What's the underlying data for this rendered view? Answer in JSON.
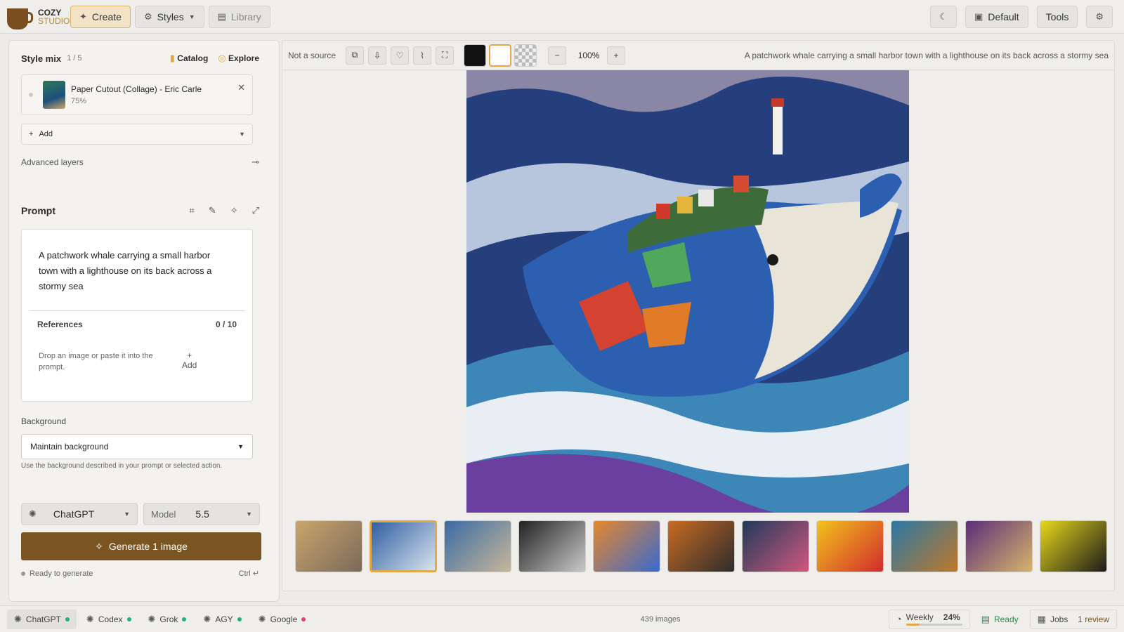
{
  "app": {
    "logo_line1": "COZY",
    "logo_line2": "STUDIO"
  },
  "topbar": {
    "create": "Create",
    "styles": "Styles",
    "library": "Library",
    "preset": "Default",
    "tools": "Tools"
  },
  "style_mix": {
    "title": "Style mix",
    "count": "1 / 5",
    "catalog": "Catalog",
    "explore": "Explore",
    "item_name": "Paper Cutout (Collage) - Eric Carle",
    "item_weight": "75%",
    "add": "Add",
    "advanced": "Advanced layers"
  },
  "prompt": {
    "title": "Prompt",
    "text": "A patchwork whale carrying a small harbor town with a lighthouse on its back across a stormy sea",
    "references_label": "References",
    "references_count": "0 / 10",
    "drop_hint": "Drop an image or paste it into the prompt.",
    "add": "Add"
  },
  "background": {
    "label": "Background",
    "value": "Maintain background",
    "hint": "Use the background described in your prompt or selected action."
  },
  "generate": {
    "provider": "ChatGPT",
    "model_label": "Model",
    "model_value": "5.5",
    "button": "Generate 1 image",
    "status": "Ready to generate",
    "shortcut": "Ctrl ↵"
  },
  "canvas": {
    "source": "Not a source",
    "zoom": "100%",
    "caption": "A patchwork whale carrying a small harbor town with a lighthouse on its back across a stormy sea"
  },
  "thumbnails": [
    {
      "name": "thumb-1",
      "c1": "#c9a56a",
      "c2": "#7b6a5c"
    },
    {
      "name": "thumb-2",
      "c1": "#2f5fa0",
      "c2": "#d9e3ef"
    },
    {
      "name": "thumb-3",
      "c1": "#3b6aa5",
      "c2": "#c6b79a"
    },
    {
      "name": "thumb-4",
      "c1": "#222222",
      "c2": "#c9c9c9"
    },
    {
      "name": "thumb-5",
      "c1": "#e7872a",
      "c2": "#3a6ad0"
    },
    {
      "name": "thumb-6",
      "c1": "#c96a22",
      "c2": "#2d2d2d"
    },
    {
      "name": "thumb-7",
      "c1": "#1f3a5a",
      "c2": "#d2577f"
    },
    {
      "name": "thumb-8",
      "c1": "#f3c21c",
      "c2": "#d12d2d"
    },
    {
      "name": "thumb-9",
      "c1": "#2a78a6",
      "c2": "#c0782a"
    },
    {
      "name": "thumb-10",
      "c1": "#5a2e7a",
      "c2": "#d6b46a"
    },
    {
      "name": "thumb-11",
      "c1": "#e7d81b",
      "c2": "#1b1b1b"
    }
  ],
  "statusbar": {
    "providers": [
      {
        "label": "ChatGPT",
        "dot": "#23b07b"
      },
      {
        "label": "Codex",
        "dot": "#23b07b"
      },
      {
        "label": "Grok",
        "dot": "#23b07b"
      },
      {
        "label": "AGY",
        "dot": "#23b07b"
      },
      {
        "label": "Google",
        "dot": "#e3456b"
      }
    ],
    "images": "439 images",
    "weekly": "Weekly",
    "weekly_pct": "24%",
    "ready": "Ready",
    "jobs": "Jobs",
    "review": "1 review"
  },
  "colors": {
    "accent": "#7a5522",
    "active_tab": "#f3e3c4",
    "ready_green": "#2f8a4e"
  }
}
